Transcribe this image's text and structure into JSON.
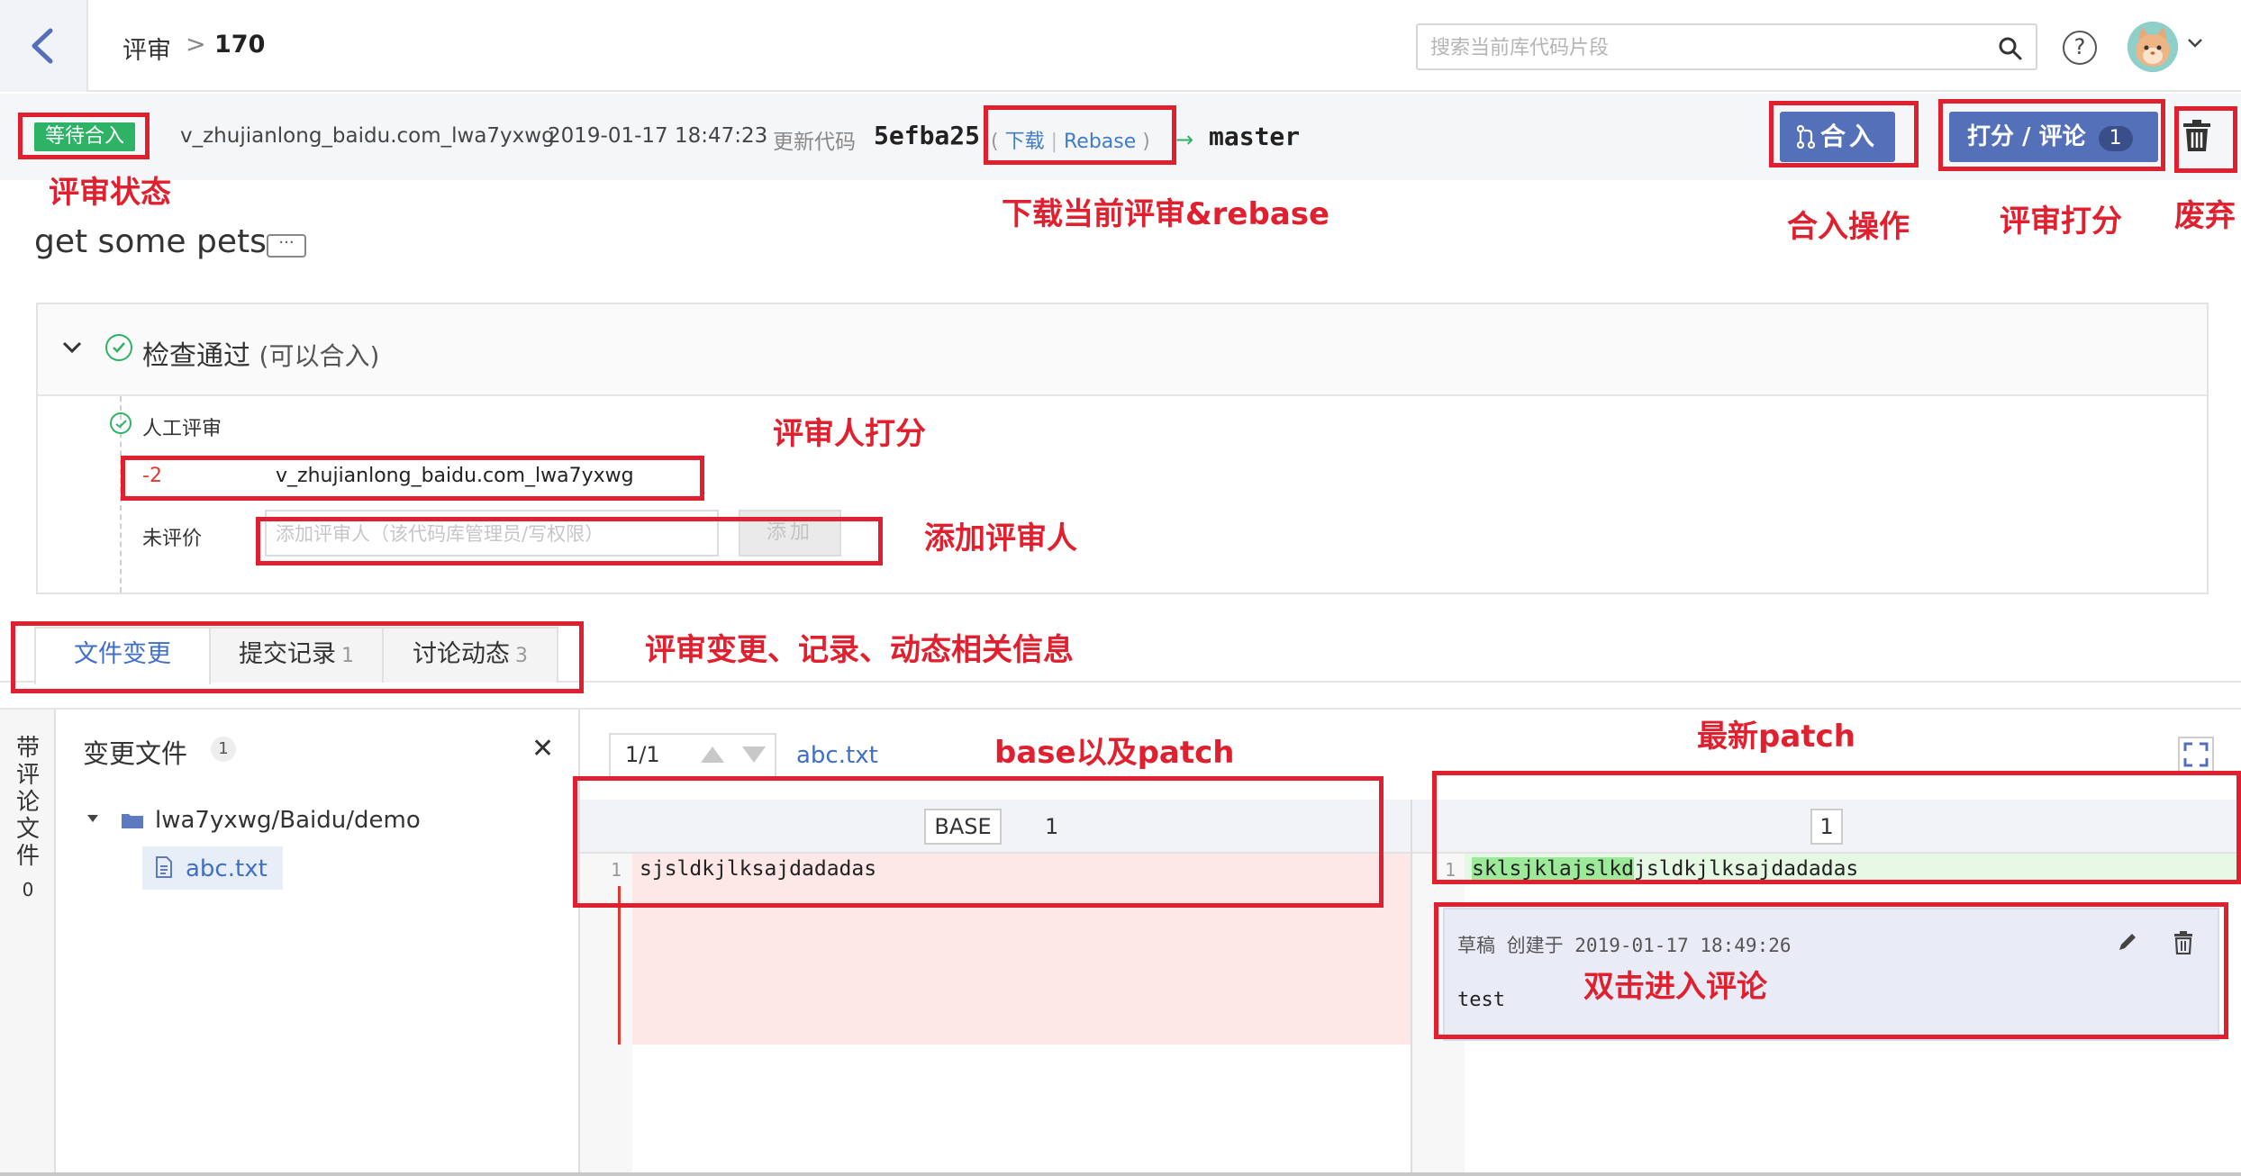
{
  "header": {
    "breadcrumb_root": "评审",
    "breadcrumb_sep": ">",
    "breadcrumb_current": "170",
    "search_placeholder": "搜索当前库代码片段",
    "help_symbol": "?"
  },
  "review": {
    "status": "等待合入",
    "author": "v_zhujianlong_baidu.com_lwa7yxwg",
    "time": "2019-01-17 18:47:23",
    "update_label": "更新代码",
    "commit": "5efba25",
    "download_label": "下载",
    "rebase_label": "Rebase",
    "arrow": "→",
    "target_branch": "master",
    "merge_button": "合入",
    "score_button": "打分 / 评论",
    "score_count": "1",
    "title": "get some pets",
    "more": "···"
  },
  "checks": {
    "status": "检查通过",
    "sub": "(可以合入)",
    "manual_review": "人工评审",
    "score": "-2",
    "reviewer": "v_zhujianlong_baidu.com_lwa7yxwg",
    "unrated_label": "未评价",
    "add_placeholder": "添加评审人（该代码库管理员/写权限）",
    "add_button": "添加"
  },
  "tabs": [
    {
      "label": "文件变更",
      "count": ""
    },
    {
      "label": "提交记录",
      "count": "1"
    },
    {
      "label": "讨论动态",
      "count": "3"
    }
  ],
  "files": {
    "side_tab": "带评论文件",
    "side_count": "0",
    "title": "变更文件",
    "count": "1",
    "close": "✕",
    "folder": "lwa7yxwg/Baidu/demo",
    "file": "abc.txt"
  },
  "diff": {
    "pager": "1/1",
    "file": "abc.txt",
    "base_label": "BASE",
    "base_patch": "1",
    "new_patch": "1",
    "line_no": "1",
    "old_line": "sjsldkjlksajdadadas",
    "new_line_hl": "sklsjklajslkd",
    "new_line_rest": "jsldkjlksajdadadas",
    "comment_meta": "草稿 创建于 2019-01-17 18:49:26",
    "comment_body": "test"
  },
  "annotations": {
    "status": "评审状态",
    "download": "下载当前评审&rebase",
    "merge": "合入操作",
    "score": "评审打分",
    "discard": "废弃",
    "reviewer_score": "评审人打分",
    "add_reviewer": "添加评审人",
    "tabs": "评审变更、记录、动态相关信息",
    "base_patch": "base以及patch",
    "latest_patch": "最新patch",
    "dblclick": "双击进入评论"
  },
  "colors": {
    "accent": "#5470b8",
    "status_green": "#2eb366",
    "annotation_red": "#e0202e",
    "link_blue": "#3f7cc9"
  }
}
